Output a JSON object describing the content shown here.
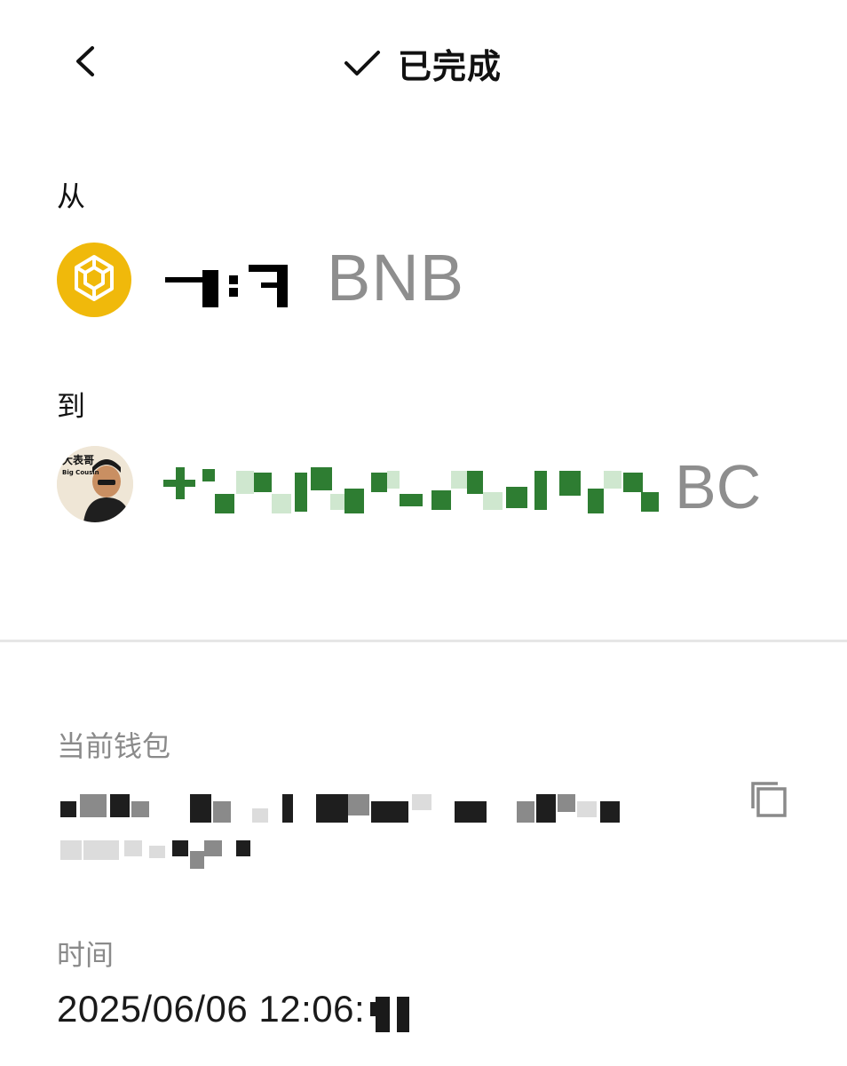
{
  "header": {
    "back_icon": "chevron-left-icon",
    "status_icon": "checkmark-icon",
    "status_text": "已完成"
  },
  "from": {
    "label": "从",
    "currency": "BNB",
    "token_icon": "bnb-logo-icon",
    "token_color": "#f0b90b"
  },
  "to": {
    "label": "到",
    "currency": "BC",
    "avatar_text": "大表哥",
    "avatar_subtext": "Big Cousin",
    "amount_color": "#2e7d32"
  },
  "wallet": {
    "label": "当前钱包",
    "copy_icon": "copy-icon"
  },
  "time": {
    "label": "时间",
    "value": "2025/06/06 12:06:"
  }
}
